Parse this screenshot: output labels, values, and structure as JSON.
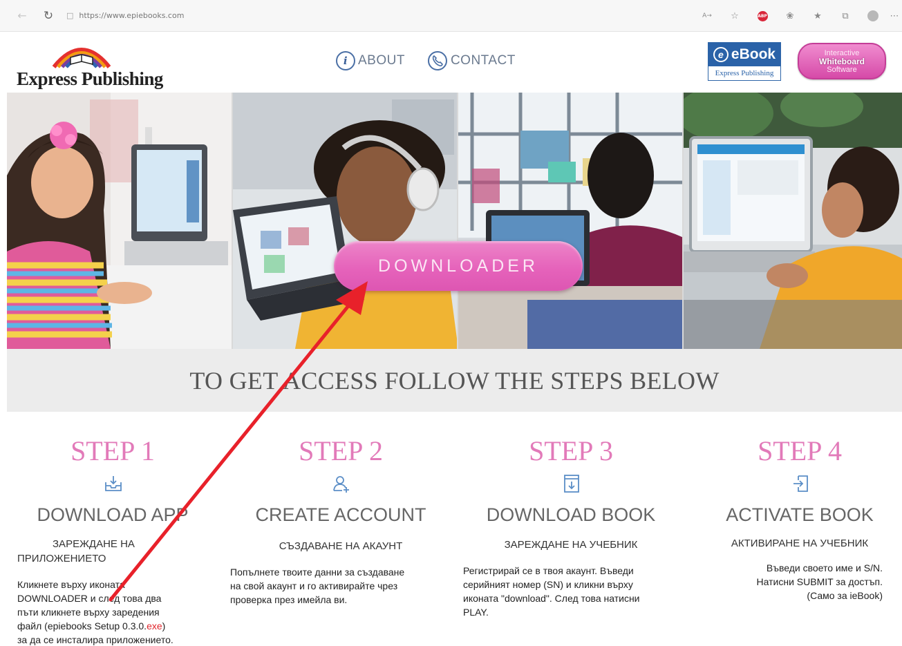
{
  "browser": {
    "url": "https://www.epiebooks.com",
    "toolbar_aa": "A→",
    "toolbar_badge": "ABP"
  },
  "header": {
    "logo_text": "Express Publishing",
    "nav": [
      {
        "label": "ABOUT",
        "icon": "info-icon"
      },
      {
        "label": "CONTACT",
        "icon": "phone-icon"
      }
    ],
    "ebook_badge": {
      "title": "eBook",
      "subtitle": "Express Publishing"
    },
    "iwb_badge": {
      "line1": "Interactive",
      "line2": "Whiteboard",
      "line3": "Software"
    }
  },
  "hero": {
    "button_label": "DOWNLOADER"
  },
  "access_banner": "TO GET ACCESS FOLLOW THE STEPS BELOW",
  "steps": [
    {
      "title": "STEP 1",
      "icon": "download-tray-icon",
      "heading": "DOWNLOAD APP",
      "sub_line1": "ЗАРЕЖДАНЕ НА",
      "sub_line2": "ПРИЛОЖЕНИЕТО",
      "desc_lines": [
        "Кликнете върху иконата",
        "DOWNLOADER и след това два",
        "пъти кликнете върху зaредения",
        "файл (epiebooks Setup 0.3.0.",
        "за да се инсталира приложението."
      ],
      "desc_exe": "exe",
      "desc_close": ")"
    },
    {
      "title": "STEP 2",
      "icon": "add-user-icon",
      "heading": "CREATE ACCOUNT",
      "sub": "СЪЗДАВАНЕ НА АКАУНТ",
      "desc_lines": [
        "Попълнете твоите данни за създаване",
        "на свой акаунт и го активирайте чрез",
        "проверка през имейла ви."
      ]
    },
    {
      "title": "STEP 3",
      "icon": "download-book-icon",
      "heading": "DOWNLOAD BOOK",
      "sub": "ЗАРЕЖДАНЕ НА УЧЕБНИК",
      "desc_lines": [
        "Регистрирай се в твоя акаунт. Въведи",
        "серийният номер (SN) и кликни върху",
        "иконата  \"download\". След това натисни",
        "PLAY."
      ]
    },
    {
      "title": "STEP 4",
      "icon": "sign-in-icon",
      "heading": "ACTIVATE BOOK",
      "sub": "АКТИВИРАНЕ НА УЧЕБНИК",
      "desc_lines": [
        "Въведи своето име и S/N.",
        "Натисни SUBMIT за достъп.",
        "(Само за ieBook)"
      ]
    }
  ],
  "colors": {
    "accent_pink": "#e27ab9",
    "button_pink": "#e663bb",
    "arrow_red": "#e8212a",
    "nav_blue": "#4a6fa5",
    "band_gray": "#ececec"
  }
}
